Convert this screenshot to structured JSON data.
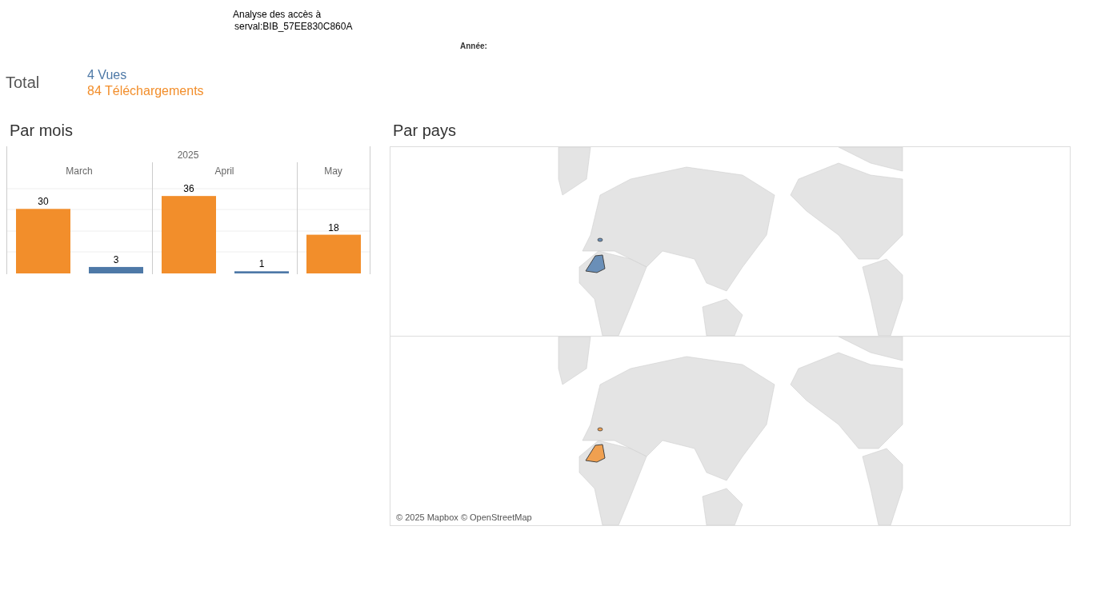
{
  "header": {
    "title_lines": [
      "Analyse des accès à",
      "serval:BIB_57EE830C860A"
    ],
    "filter_label": "Année:"
  },
  "totals": {
    "label": "Total",
    "views": "4 Vues",
    "downloads": "84 Téléchargements"
  },
  "by_month": {
    "title": "Par mois",
    "year": "2025",
    "chart_data": {
      "type": "bar",
      "categories": [
        "March",
        "April",
        "May"
      ],
      "series": [
        {
          "color": "#f28e2b",
          "values": [
            30,
            36,
            18
          ]
        },
        {
          "color": "#4e79a7",
          "values": [
            3,
            1,
            null
          ]
        }
      ],
      "data_labels": true
    }
  },
  "by_country": {
    "title": "Par pays",
    "maps": [
      {
        "color": "#6a8fb8"
      },
      {
        "color": "#f0a050"
      }
    ],
    "attribution": "© 2025 Mapbox © OpenStreetMap"
  }
}
